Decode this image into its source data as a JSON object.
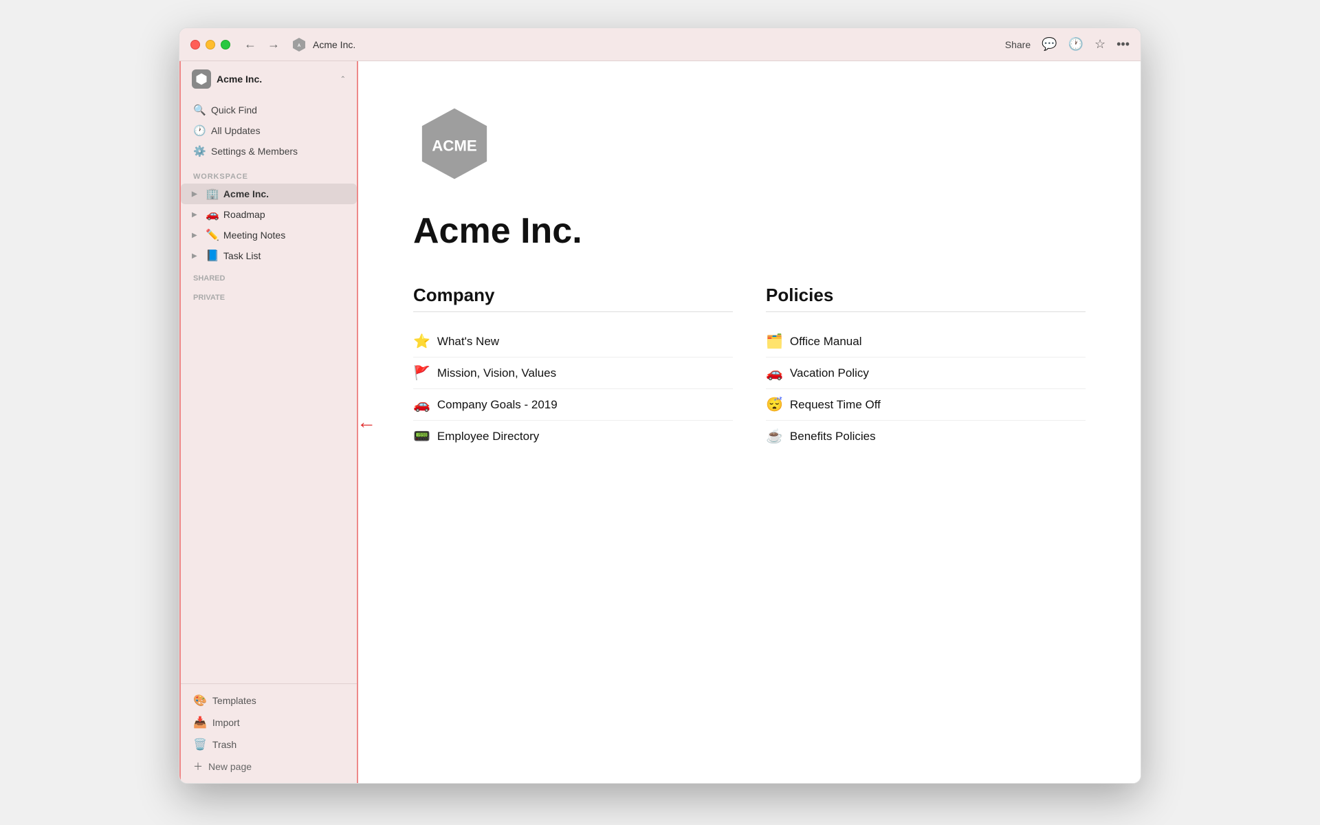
{
  "window": {
    "title": "Acme Inc."
  },
  "traffic_lights": {
    "red_label": "close",
    "yellow_label": "minimize",
    "green_label": "maximize"
  },
  "titlebar": {
    "back_label": "←",
    "forward_label": "→",
    "page_title": "Acme Inc.",
    "share_label": "Share",
    "comment_icon": "💬",
    "history_icon": "🕐",
    "star_icon": "☆",
    "more_icon": "•••"
  },
  "sidebar": {
    "workspace_name": "Acme Inc.",
    "nav_items": [
      {
        "id": "quick-find",
        "icon": "🔍",
        "label": "Quick Find"
      },
      {
        "id": "all-updates",
        "icon": "🕐",
        "label": "All Updates"
      },
      {
        "id": "settings",
        "icon": "⚙️",
        "label": "Settings & Members"
      }
    ],
    "workspace_label": "WORKSPACE",
    "workspace_items": [
      {
        "id": "acme",
        "emoji": "🏢",
        "label": "Acme Inc.",
        "active": true
      },
      {
        "id": "roadmap",
        "emoji": "🚗",
        "label": "Roadmap"
      },
      {
        "id": "meeting-notes",
        "emoji": "✏️",
        "label": "Meeting Notes"
      },
      {
        "id": "task-list",
        "emoji": "📘",
        "label": "Task List"
      }
    ],
    "shared_label": "SHARED",
    "private_label": "PRIVATE",
    "bottom_items": [
      {
        "id": "templates",
        "icon": "🎨",
        "label": "Templates"
      },
      {
        "id": "import",
        "icon": "📥",
        "label": "Import"
      },
      {
        "id": "trash",
        "icon": "🗑️",
        "label": "Trash"
      }
    ],
    "new_page_label": "New page"
  },
  "content": {
    "page_title": "Acme Inc.",
    "company_section": {
      "title": "Company",
      "links": [
        {
          "emoji": "⭐",
          "label": "What's New"
        },
        {
          "emoji": "🚩",
          "label": "Mission, Vision, Values"
        },
        {
          "emoji": "🚗",
          "label": "Company Goals - 2019"
        },
        {
          "emoji": "📟",
          "label": "Employee Directory"
        }
      ]
    },
    "policies_section": {
      "title": "Policies",
      "links": [
        {
          "emoji": "🗂️",
          "label": "Office Manual"
        },
        {
          "emoji": "🚗",
          "label": "Vacation Policy"
        },
        {
          "emoji": "😴",
          "label": "Request Time Off"
        },
        {
          "emoji": "☕",
          "label": "Benefits Policies"
        }
      ]
    }
  },
  "hexagon": {
    "fill": "#9e9e9e",
    "text": "ACME",
    "text_color": "#fff"
  }
}
